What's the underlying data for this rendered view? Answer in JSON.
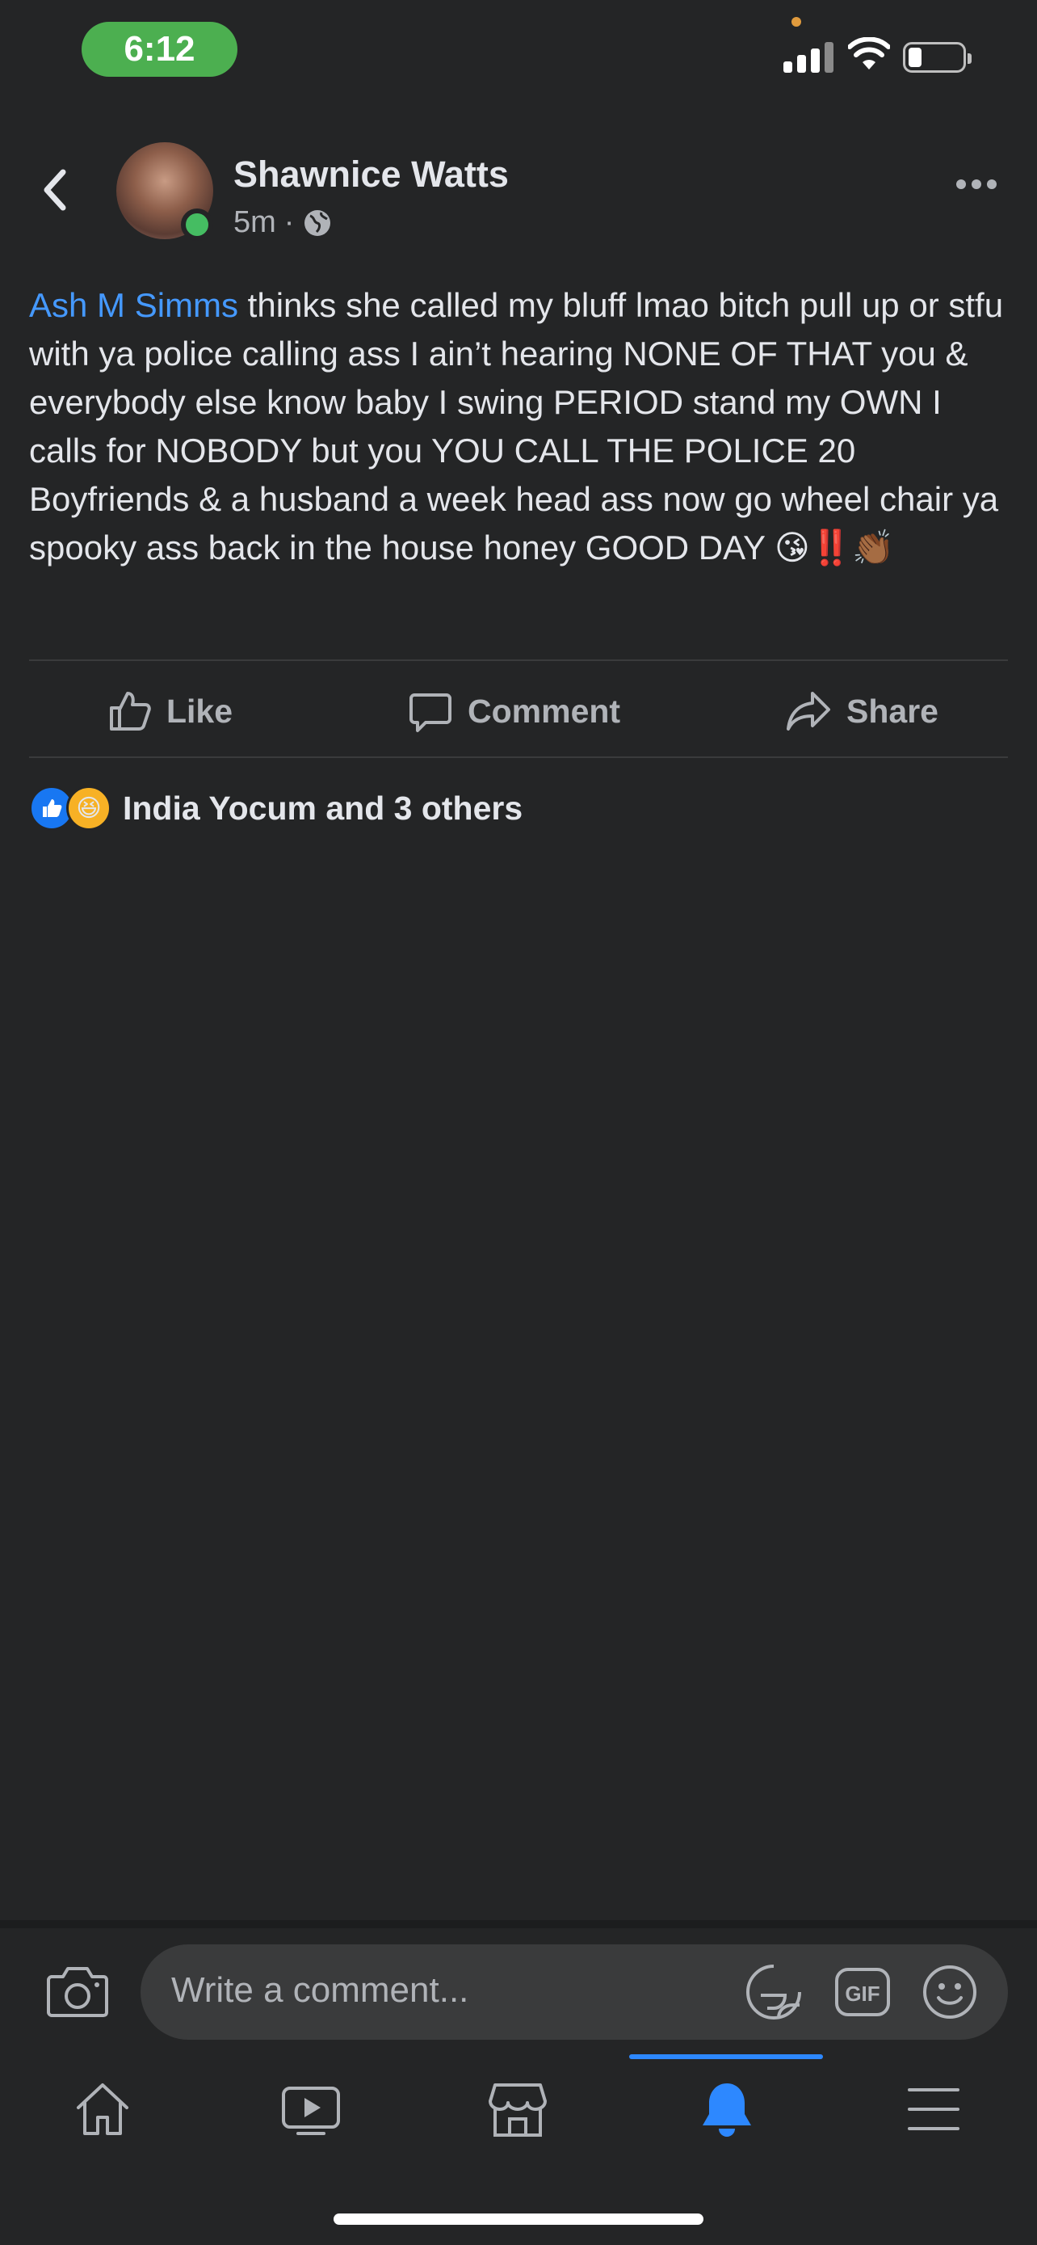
{
  "status_bar": {
    "time": "6:12"
  },
  "post": {
    "author": "Shawnice Watts",
    "time_ago": "5m",
    "separator": "·",
    "mention": "Ash M Simms",
    "text": " thinks she called my bluff lmao bitch pull up or stfu with ya police calling ass I ain’t hearing NONE OF THAT you & everybody else know baby I swing PERIOD stand my OWN I calls for NOBODY but you YOU CALL THE POLICE 20 Boyfriends & a husband a week head ass now go wheel chair ya spooky ass back in the house honey GOOD DAY ",
    "emojis": "😘‼️👏🏾"
  },
  "actions": {
    "like": "Like",
    "comment": "Comment",
    "share": "Share"
  },
  "reactions": {
    "summary": "India Yocum and 3 others"
  },
  "comment_box": {
    "placeholder": "Write a comment..."
  },
  "colors": {
    "accent": "#2d88ff",
    "mention": "#4599ff",
    "online": "#45bd62",
    "time_pill": "#4caf50"
  },
  "icons": [
    "back-icon",
    "more-icon",
    "globe-icon",
    "like-icon",
    "comment-icon",
    "share-icon",
    "camera-icon",
    "sticker-icon",
    "gif-icon",
    "emoji-icon",
    "home-icon",
    "watch-icon",
    "marketplace-icon",
    "notifications-icon",
    "menu-icon"
  ],
  "tabs": {
    "active": "notifications"
  }
}
